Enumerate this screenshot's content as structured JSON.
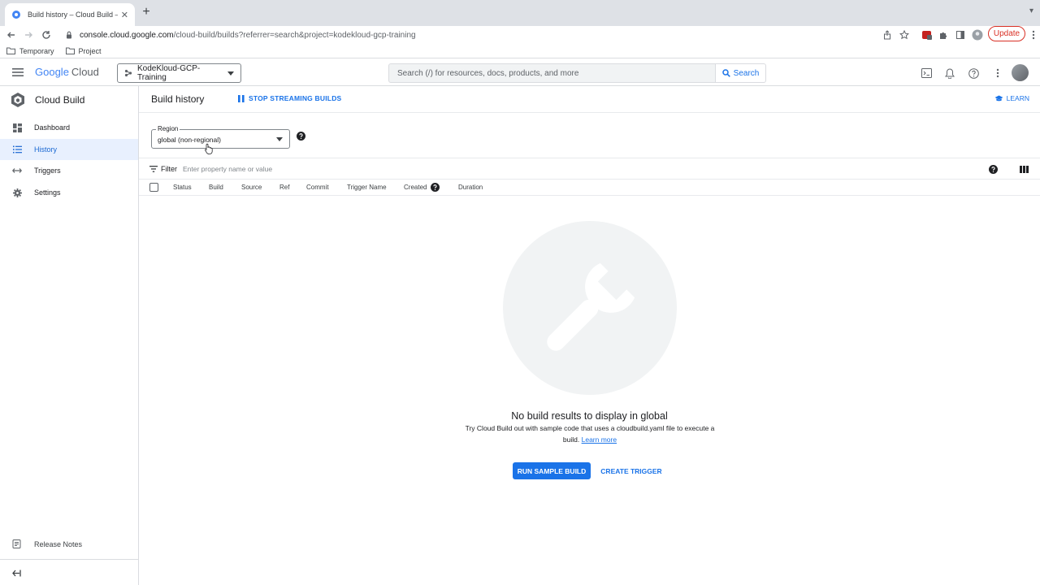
{
  "browser": {
    "tab_title": "Build history – Cloud Build – K",
    "url_host": "console.cloud.google.com",
    "url_path": "/cloud-build/builds?referrer=search&project=kodekloud-gcp-training",
    "update_label": "Update",
    "bookmarks": [
      "Temporary",
      "Project"
    ]
  },
  "topbar": {
    "logo_google": "Google",
    "logo_cloud": "Cloud",
    "project": "KodeKloud-GCP-Training",
    "search_placeholder": "Search (/) for resources, docs, products, and more",
    "search_button": "Search"
  },
  "sidenav": {
    "product_title": "Cloud Build",
    "items": [
      {
        "label": "Dashboard",
        "icon": "dashboard-icon"
      },
      {
        "label": "History",
        "icon": "list-icon",
        "active": true
      },
      {
        "label": "Triggers",
        "icon": "arrows-icon"
      },
      {
        "label": "Settings",
        "icon": "gear-icon"
      }
    ],
    "release_notes": "Release Notes"
  },
  "page": {
    "title": "Build history",
    "stop_streaming": "STOP STREAMING BUILDS",
    "learn": "LEARN",
    "region_label": "Region",
    "region_value": "global (non-regional)",
    "filter_label": "Filter",
    "filter_placeholder": "Enter property name or value",
    "columns": [
      "Status",
      "Build",
      "Source",
      "Ref",
      "Commit",
      "Trigger Name",
      "Created",
      "Duration"
    ],
    "empty_title": "No build results to display in global",
    "empty_desc_lead": "Try Cloud Build out with sample code that uses a cloudbuild.yaml file to execute a build.",
    "empty_desc_link": "Learn more",
    "run_sample_build": "RUN SAMPLE BUILD",
    "create_trigger": "CREATE TRIGGER"
  },
  "colors": {
    "accent": "#1a73e8",
    "active_nav_bg": "#e8f0fe",
    "update_red": "#d93025"
  }
}
